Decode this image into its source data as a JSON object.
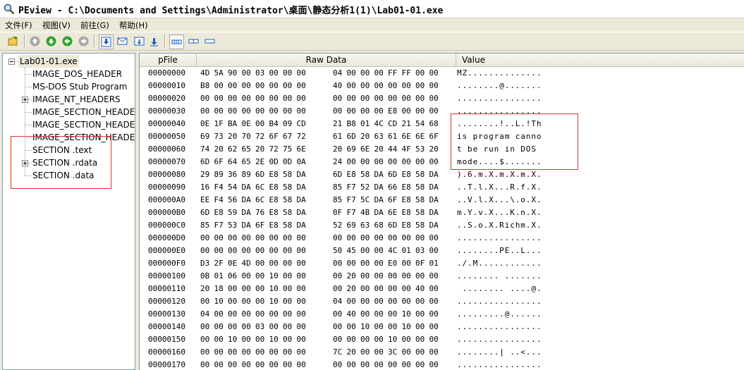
{
  "window": {
    "title": "PEview - C:\\Documents and Settings\\Administrator\\桌面\\静态分析1(1)\\Lab01-01.exe",
    "icon": "magnifier-icon"
  },
  "menu": [
    {
      "label": "文件(F)"
    },
    {
      "label": "视图(V)"
    },
    {
      "label": "前往(G)"
    },
    {
      "label": "帮助(H)"
    }
  ],
  "toolbar": [
    {
      "name": "open-icon",
      "color": "#e8b020"
    },
    {
      "name": "back-up-icon",
      "color": "#8a8a8a"
    },
    {
      "name": "down-icon",
      "color": "#2aa52a"
    },
    {
      "name": "up-icon",
      "color": "#2aa52a"
    },
    {
      "name": "forward-icon",
      "color": "#8a8a8a"
    },
    {
      "name": "save-down-icon",
      "color": "#1f5fbf"
    },
    {
      "name": "mail-icon",
      "color": "#1f5fbf"
    },
    {
      "name": "export-icon",
      "color": "#1f5fbf"
    },
    {
      "name": "import-icon",
      "color": "#1f5fbf"
    },
    {
      "name": "view-bytes-icon",
      "color": "#1f5fbf"
    },
    {
      "name": "view-words-icon",
      "color": "#1f5fbf"
    },
    {
      "name": "view-dwords-icon",
      "color": "#1f5fbf"
    }
  ],
  "tree": {
    "root": "Lab01-01.exe",
    "items": [
      {
        "label": "IMAGE_DOS_HEADER",
        "expandable": false
      },
      {
        "label": "MS-DOS Stub Program",
        "expandable": false
      },
      {
        "label": "IMAGE_NT_HEADERS",
        "expandable": true
      },
      {
        "label": "IMAGE_SECTION_HEADER .text",
        "expandable": false
      },
      {
        "label": "IMAGE_SECTION_HEADER .rdata",
        "expandable": false
      },
      {
        "label": "IMAGE_SECTION_HEADER .data",
        "expandable": false
      },
      {
        "label": "SECTION .text",
        "expandable": false
      },
      {
        "label": "SECTION .rdata",
        "expandable": true
      },
      {
        "label": "SECTION .data",
        "expandable": false
      }
    ]
  },
  "columns": {
    "pfile": "pFile",
    "raw": "Raw Data",
    "value": "Value"
  },
  "rows": [
    {
      "offset": "00000000",
      "bytes": [
        "4D",
        "5A",
        "90",
        "00",
        "03",
        "00",
        "00",
        "00",
        "04",
        "00",
        "00",
        "00",
        "FF",
        "FF",
        "00",
        "00"
      ],
      "ascii": "MZ.............."
    },
    {
      "offset": "00000010",
      "bytes": [
        "B8",
        "00",
        "00",
        "00",
        "00",
        "00",
        "00",
        "00",
        "40",
        "00",
        "00",
        "00",
        "00",
        "00",
        "00",
        "00"
      ],
      "ascii": "........@......."
    },
    {
      "offset": "00000020",
      "bytes": [
        "00",
        "00",
        "00",
        "00",
        "00",
        "00",
        "00",
        "00",
        "00",
        "00",
        "00",
        "00",
        "00",
        "00",
        "00",
        "00"
      ],
      "ascii": "................"
    },
    {
      "offset": "00000030",
      "bytes": [
        "00",
        "00",
        "00",
        "00",
        "00",
        "00",
        "00",
        "00",
        "00",
        "00",
        "00",
        "00",
        "E8",
        "00",
        "00",
        "00"
      ],
      "ascii": "................"
    },
    {
      "offset": "00000040",
      "bytes": [
        "0E",
        "1F",
        "BA",
        "0E",
        "00",
        "B4",
        "09",
        "CD",
        "21",
        "B8",
        "01",
        "4C",
        "CD",
        "21",
        "54",
        "68"
      ],
      "ascii": "........!..L.!Th"
    },
    {
      "offset": "00000050",
      "bytes": [
        "69",
        "73",
        "20",
        "70",
        "72",
        "6F",
        "67",
        "72",
        "61",
        "6D",
        "20",
        "63",
        "61",
        "6E",
        "6E",
        "6F"
      ],
      "ascii": "is program canno"
    },
    {
      "offset": "00000060",
      "bytes": [
        "74",
        "20",
        "62",
        "65",
        "20",
        "72",
        "75",
        "6E",
        "20",
        "69",
        "6E",
        "20",
        "44",
        "4F",
        "53",
        "20"
      ],
      "ascii": "t be run in DOS "
    },
    {
      "offset": "00000070",
      "bytes": [
        "6D",
        "6F",
        "64",
        "65",
        "2E",
        "0D",
        "0D",
        "0A",
        "24",
        "00",
        "00",
        "00",
        "00",
        "00",
        "00",
        "00"
      ],
      "ascii": "mode....$......."
    },
    {
      "offset": "00000080",
      "bytes": [
        "29",
        "89",
        "36",
        "89",
        "6D",
        "E8",
        "58",
        "DA",
        "6D",
        "E8",
        "58",
        "DA",
        "6D",
        "E8",
        "58",
        "DA"
      ],
      "ascii": ").6.m.X.m.X.m.X."
    },
    {
      "offset": "00000090",
      "bytes": [
        "16",
        "F4",
        "54",
        "DA",
        "6C",
        "E8",
        "58",
        "DA",
        "85",
        "F7",
        "52",
        "DA",
        "66",
        "E8",
        "58",
        "DA"
      ],
      "ascii": "..T.l.X...R.f.X."
    },
    {
      "offset": "000000A0",
      "bytes": [
        "EE",
        "F4",
        "56",
        "DA",
        "6C",
        "E8",
        "58",
        "DA",
        "85",
        "F7",
        "5C",
        "DA",
        "6F",
        "E8",
        "58",
        "DA"
      ],
      "ascii": "..V.l.X...\\.o.X."
    },
    {
      "offset": "000000B0",
      "bytes": [
        "6D",
        "E8",
        "59",
        "DA",
        "76",
        "E8",
        "58",
        "DA",
        "0F",
        "F7",
        "4B",
        "DA",
        "6E",
        "E8",
        "58",
        "DA"
      ],
      "ascii": "m.Y.v.X...K.n.X."
    },
    {
      "offset": "000000C0",
      "bytes": [
        "85",
        "F7",
        "53",
        "DA",
        "6F",
        "E8",
        "58",
        "DA",
        "52",
        "69",
        "63",
        "68",
        "6D",
        "E8",
        "58",
        "DA"
      ],
      "ascii": "..S.o.X.Richm.X."
    },
    {
      "offset": "000000D0",
      "bytes": [
        "00",
        "00",
        "00",
        "00",
        "00",
        "00",
        "00",
        "00",
        "00",
        "00",
        "00",
        "00",
        "00",
        "00",
        "00",
        "00"
      ],
      "ascii": "................"
    },
    {
      "offset": "000000E0",
      "bytes": [
        "00",
        "00",
        "00",
        "00",
        "00",
        "00",
        "00",
        "00",
        "50",
        "45",
        "00",
        "00",
        "4C",
        "01",
        "03",
        "00"
      ],
      "ascii": "........PE..L..."
    },
    {
      "offset": "000000F0",
      "bytes": [
        "D3",
        "2F",
        "0E",
        "4D",
        "00",
        "00",
        "00",
        "00",
        "00",
        "00",
        "00",
        "00",
        "E0",
        "00",
        "0F",
        "01"
      ],
      "ascii": "./.M............"
    },
    {
      "offset": "00000100",
      "bytes": [
        "0B",
        "01",
        "06",
        "00",
        "00",
        "10",
        "00",
        "00",
        "00",
        "20",
        "00",
        "00",
        "00",
        "00",
        "00",
        "00"
      ],
      "ascii": "........ ......."
    },
    {
      "offset": "00000110",
      "bytes": [
        "20",
        "18",
        "00",
        "00",
        "00",
        "10",
        "00",
        "00",
        "00",
        "20",
        "00",
        "00",
        "00",
        "00",
        "40",
        "00"
      ],
      "ascii": " ........ ....@."
    },
    {
      "offset": "00000120",
      "bytes": [
        "00",
        "10",
        "00",
        "00",
        "00",
        "10",
        "00",
        "00",
        "04",
        "00",
        "00",
        "00",
        "00",
        "00",
        "00",
        "00"
      ],
      "ascii": "................"
    },
    {
      "offset": "00000130",
      "bytes": [
        "04",
        "00",
        "00",
        "00",
        "00",
        "00",
        "00",
        "00",
        "00",
        "40",
        "00",
        "00",
        "00",
        "10",
        "00",
        "00"
      ],
      "ascii": ".........@......"
    },
    {
      "offset": "00000140",
      "bytes": [
        "00",
        "00",
        "00",
        "00",
        "03",
        "00",
        "00",
        "00",
        "00",
        "00",
        "10",
        "00",
        "00",
        "10",
        "00",
        "00"
      ],
      "ascii": "................"
    },
    {
      "offset": "00000150",
      "bytes": [
        "00",
        "00",
        "10",
        "00",
        "00",
        "10",
        "00",
        "00",
        "00",
        "00",
        "00",
        "00",
        "10",
        "00",
        "00",
        "00"
      ],
      "ascii": "................"
    },
    {
      "offset": "00000160",
      "bytes": [
        "00",
        "00",
        "00",
        "00",
        "00",
        "00",
        "00",
        "00",
        "7C",
        "20",
        "00",
        "00",
        "3C",
        "00",
        "00",
        "00"
      ],
      "ascii": "........| ..<..."
    },
    {
      "offset": "00000170",
      "bytes": [
        "00",
        "00",
        "00",
        "00",
        "00",
        "00",
        "00",
        "00",
        "00",
        "00",
        "00",
        "00",
        "00",
        "00",
        "00",
        "00"
      ],
      "ascii": "................"
    }
  ]
}
